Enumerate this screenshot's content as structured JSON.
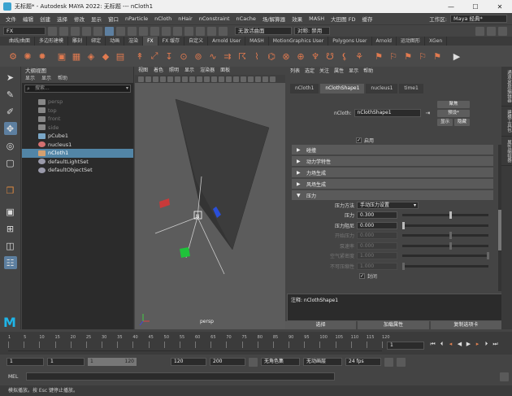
{
  "window": {
    "title": "无标题* - Autodesk MAYA 2022: 无标题   ---   nCloth1",
    "controls": [
      "—",
      "☐",
      "✕"
    ]
  },
  "menubar": {
    "items": [
      "文件",
      "编辑",
      "创建",
      "选择",
      "修改",
      "显示",
      "窗口",
      "nParticle",
      "nCloth",
      "nHair",
      "nConstraint",
      "nCache",
      "场/解算器",
      "效果",
      "MASH",
      "大田图 FD",
      "缓存"
    ],
    "workspace_label": "工作区:",
    "workspace_value": "Maya 经典*"
  },
  "statusline": {
    "mode_value": "FX",
    "live_surface": "无激活曲面",
    "symmetry": "对称: 禁用"
  },
  "shelf_tabs": {
    "items": [
      "曲线/曲面",
      "多边形建模",
      "雕刻",
      "绑定",
      "动画",
      "渲染",
      "FX",
      "FX 缓存",
      "自定义",
      "Arnold User",
      "MASH",
      "MotionGraphics User",
      "Polygons User",
      "Arnold",
      "运动图形",
      "XGen"
    ],
    "active_index": 6
  },
  "outliner": {
    "title": "大纲视图",
    "menu": [
      "显示",
      "显示",
      "帮助"
    ],
    "search_placeholder": "搜索...",
    "items": [
      {
        "label": "persp",
        "dim": true,
        "icon": "camera-icon"
      },
      {
        "label": "top",
        "dim": true,
        "icon": "camera-icon"
      },
      {
        "label": "front",
        "dim": true,
        "icon": "camera-icon"
      },
      {
        "label": "side",
        "dim": true,
        "icon": "camera-icon"
      },
      {
        "label": "pCube1",
        "dim": false,
        "icon": "mesh-icon"
      },
      {
        "label": "nucleus1",
        "dim": false,
        "icon": "nucleus-icon"
      },
      {
        "label": "nCloth1",
        "dim": false,
        "icon": "ncloth-icon",
        "selected": true
      },
      {
        "label": "defaultLightSet",
        "dim": false,
        "icon": "set-icon"
      },
      {
        "label": "defaultObjectSet",
        "dim": false,
        "icon": "set-icon"
      }
    ]
  },
  "viewport": {
    "menu": [
      "视图",
      "着色",
      "照明",
      "显示",
      "渲染器",
      "面板"
    ],
    "camera_label": "persp"
  },
  "attribute_editor": {
    "menu": [
      "列表",
      "选定",
      "关注",
      "属性",
      "显示",
      "帮助"
    ],
    "tabs": [
      "nCloth1",
      "nClothShape1",
      "nucleus1",
      "time1"
    ],
    "active_tab": 1,
    "node_label": "nCloth:",
    "node_value": "nClothShape1",
    "focus_btn": "聚焦",
    "preset_btn": "预设*",
    "show_btn": "显示",
    "hide_btn": "隐藏",
    "enable_label": "启用",
    "enable_checked": true,
    "sections": [
      "碰撞",
      "动力学特性",
      "力场生成",
      "风场生成",
      "压力"
    ],
    "pressure": {
      "method_label": "压力方法",
      "method_value": "手动压力设置",
      "rows": [
        {
          "label": "压力",
          "value": "0.300",
          "slider": 0.55,
          "disabled": false
        },
        {
          "label": "压力阻尼",
          "value": "0.000",
          "slider": 0.0,
          "disabled": false
        },
        {
          "label": "开始压力",
          "value": "0.000",
          "slider": 0.55,
          "disabled": true
        },
        {
          "label": "泵速率",
          "value": "0.000",
          "slider": 0.55,
          "disabled": true
        },
        {
          "label": "空气紧密度",
          "value": "1.000",
          "slider": 0.98,
          "disabled": true
        },
        {
          "label": "不可压缩性",
          "value": "1.000",
          "slider": 0.0,
          "disabled": true
        }
      ],
      "seal_label": "封闭",
      "seal_checked": true
    },
    "notes_label": "注释: nClothShape1",
    "bottom_buttons": [
      "选择",
      "加载属性",
      "复制选项卡"
    ]
  },
  "side_tabs": [
    "通道盒/层编辑器",
    "建模工具包",
    "属性编辑器"
  ],
  "timeslider": {
    "ticks": [
      "1",
      "5",
      "10",
      "15",
      "20",
      "25",
      "30",
      "35",
      "40",
      "45",
      "50",
      "55",
      "60",
      "65",
      "70",
      "75",
      "80",
      "85",
      "90",
      "95",
      "100",
      "105",
      "110",
      "115",
      "120"
    ],
    "current_frame": "1"
  },
  "rangebar": {
    "start": "1",
    "anim_start": "1",
    "range_min": "1",
    "range_max": "120",
    "anim_end": "120",
    "end": "200",
    "char_set": "无角色集",
    "anim_layer": "无动画层",
    "fps": "24 fps"
  },
  "command_line": {
    "label": "MEL"
  },
  "help_line": "模拟播放。按 Esc 键停止播放。",
  "colors": {
    "selection": "#5285a6",
    "accent": "#e07a50",
    "maya_logo": "#1fb5e8"
  }
}
